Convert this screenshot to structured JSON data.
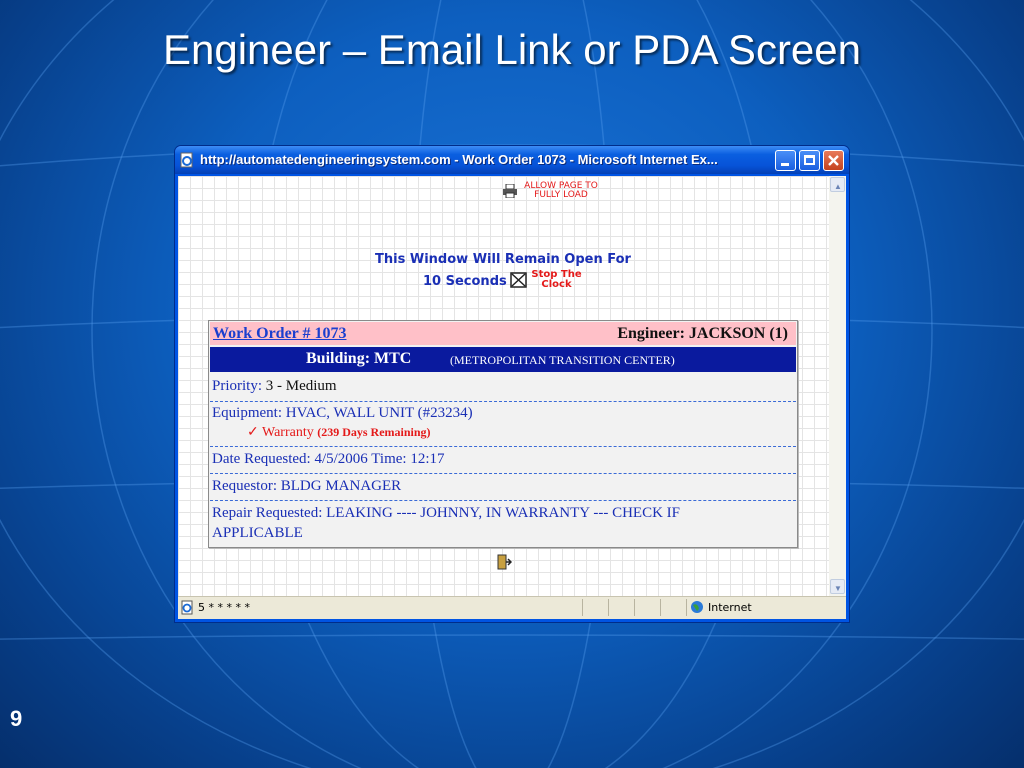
{
  "slide": {
    "title": "Engineer – Email Link or PDA Screen",
    "page_number": "9"
  },
  "window": {
    "title": "http://automatedengineeringsystem.com - Work Order 1073 - Microsoft Internet Ex...",
    "controls": [
      "minimize",
      "maximize",
      "close"
    ]
  },
  "page": {
    "allow_load_line1": "ALLOW PAGE TO",
    "allow_load_line2": "FULLY LOAD",
    "remain_open": "This Window Will Remain Open For",
    "seconds": "10 Seconds",
    "stop_line1": "Stop The",
    "stop_line2": "Clock"
  },
  "work_order": {
    "link": "Work Order # 1073",
    "engineer": "Engineer: JACKSON (1)",
    "building_label": "Building:  MTC",
    "building_full": "(METROPOLITAN TRANSITION CENTER)",
    "priority_label": "Priority:",
    "priority_value": "3 - Medium",
    "equipment": "Equipment:  HVAC, WALL UNIT  (#23234)",
    "warranty_check": "✓",
    "warranty": "Warranty",
    "warranty_days": "(239 Days Remaining)",
    "date_requested": "Date Requested:  4/5/2006   Time:  12:17",
    "requestor": "Requestor:  BLDG MANAGER",
    "repair_line1": "Repair Requested:  LEAKING ---- JOHNNY, IN WARRANTY --- CHECK IF",
    "repair_line2": "APPLICABLE"
  },
  "status_bar": {
    "text": "5 * * * * *",
    "zone": "Internet"
  },
  "colors": {
    "slide_bg": "#0d5fbf",
    "titlebar": "#0753d8",
    "header_pink": "#ffc0c8",
    "building_bar": "#0a1a9e",
    "link_blue": "#1a2fb5",
    "alert_red": "#e41a1a"
  }
}
